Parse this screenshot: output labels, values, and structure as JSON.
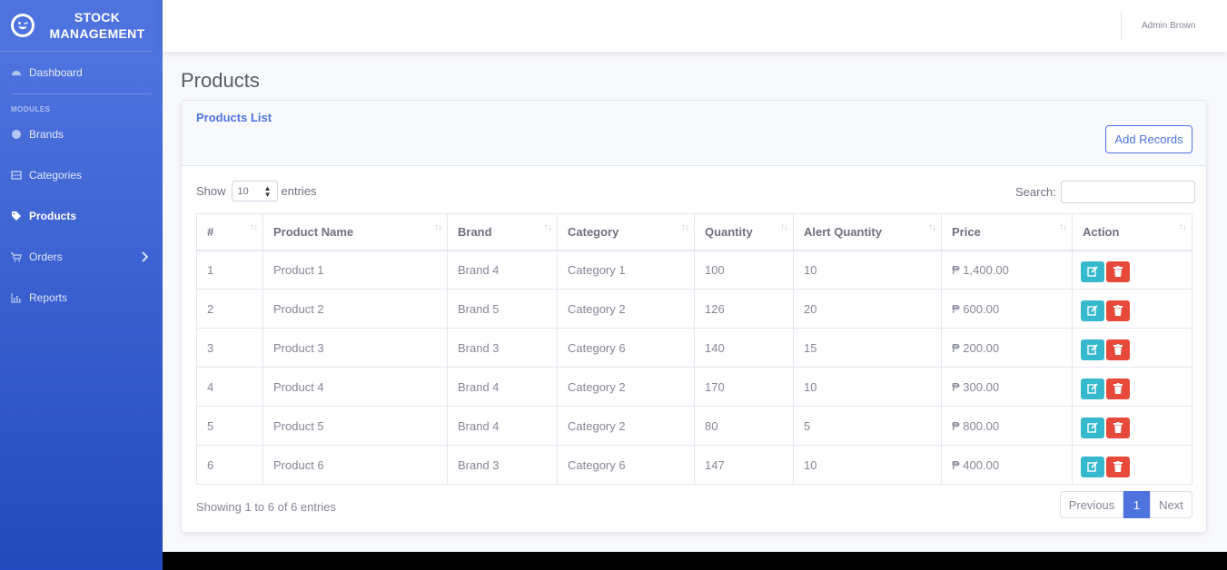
{
  "brand": {
    "line1": "STOCK",
    "line2": "MANAGEMENT"
  },
  "sidebar": {
    "dashboard": "Dashboard",
    "modules_heading": "MODULES",
    "items": [
      {
        "label": "Brands",
        "icon": "circle-icon"
      },
      {
        "label": "Categories",
        "icon": "list-icon"
      },
      {
        "label": "Products",
        "icon": "tag-icon",
        "active": true
      },
      {
        "label": "Orders",
        "icon": "cart-icon"
      },
      {
        "label": "Reports",
        "icon": "chart-icon"
      }
    ]
  },
  "topbar": {
    "user": "Admin Brown"
  },
  "page": {
    "title": "Products"
  },
  "card": {
    "title": "Products List",
    "add_button": "Add Records",
    "show_label": "Show",
    "entries_value": "10",
    "entries_label": "entries",
    "search_label": "Search:",
    "search_value": ""
  },
  "table": {
    "headers": [
      "#",
      "Product Name",
      "Brand",
      "Category",
      "Quantity",
      "Alert Quantity",
      "Price",
      "Action"
    ],
    "rows": [
      [
        "1",
        "Product 1",
        "Brand 4",
        "Category 1",
        "100",
        "10",
        "₱ 1,400.00"
      ],
      [
        "2",
        "Product 2",
        "Brand 5",
        "Category 2",
        "126",
        "20",
        "₱ 600.00"
      ],
      [
        "3",
        "Product 3",
        "Brand 3",
        "Category 6",
        "140",
        "15",
        "₱ 200.00"
      ],
      [
        "4",
        "Product 4",
        "Brand 4",
        "Category 2",
        "170",
        "10",
        "₱ 300.00"
      ],
      [
        "5",
        "Product 5",
        "Brand 4",
        "Category 2",
        "80",
        "5",
        "₱ 800.00"
      ],
      [
        "6",
        "Product 6",
        "Brand 3",
        "Category 6",
        "147",
        "10",
        "₱ 400.00"
      ]
    ]
  },
  "footer": {
    "info": "Showing 1 to 6 of 6 entries",
    "prev": "Previous",
    "current": "1",
    "next": "Next"
  },
  "colors": {
    "primary": "#4e73df",
    "edit": "#36b9cc",
    "delete": "#e74a3b"
  }
}
